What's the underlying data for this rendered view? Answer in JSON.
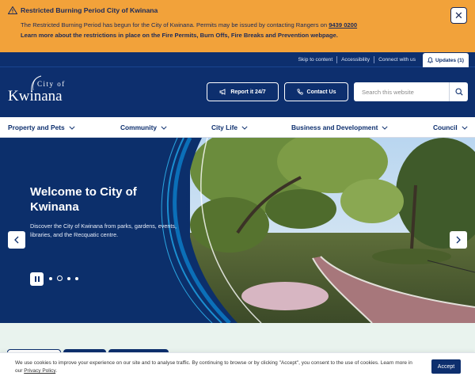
{
  "alert": {
    "title": "Restricted Burning Period City of Kwinana",
    "body_text": "The Restricted Burning Period has begun for the City of Kwinana. Permits may be issued by contacting Rangers on ",
    "phone": "9439 0200",
    "learn_more": "Learn more about the restrictions in place on the Fire Permits, Burn Offs, Fire Breaks and Prevention webpage.",
    "close_label": "✕"
  },
  "utility": {
    "links": [
      "Skip to content",
      "Accessibility",
      "Connect with us"
    ],
    "updates_label": "Updates (1)"
  },
  "header": {
    "logo_small": "City of",
    "logo_big": "Kwinana",
    "report_label": "Report it 24/7",
    "contact_label": "Contact Us",
    "search_placeholder": "Search this website"
  },
  "nav": {
    "items": [
      "Property and Pets",
      "Community",
      "City Life",
      "Business and Development",
      "Council"
    ]
  },
  "hero": {
    "title": "Welcome to City of Kwinana",
    "text": "Discover the City of Kwinana from parks, gardens, events, libraries, and the Recquatic centre.",
    "slide_count": 4,
    "active_slide": 2
  },
  "cookie": {
    "text": "We use cookies to improve your experience on our site and to analyse traffic. By continuing to browse or by clicking \"Accept\", you consent to the use of cookies. Learn more in our ",
    "link": "Privacy Policy",
    "period": ".",
    "accept_label": "Accept"
  },
  "colors": {
    "alert_bg": "#f2a23a",
    "brand_navy": "#0d2f6e",
    "lower_bg": "#e9f3ee"
  }
}
